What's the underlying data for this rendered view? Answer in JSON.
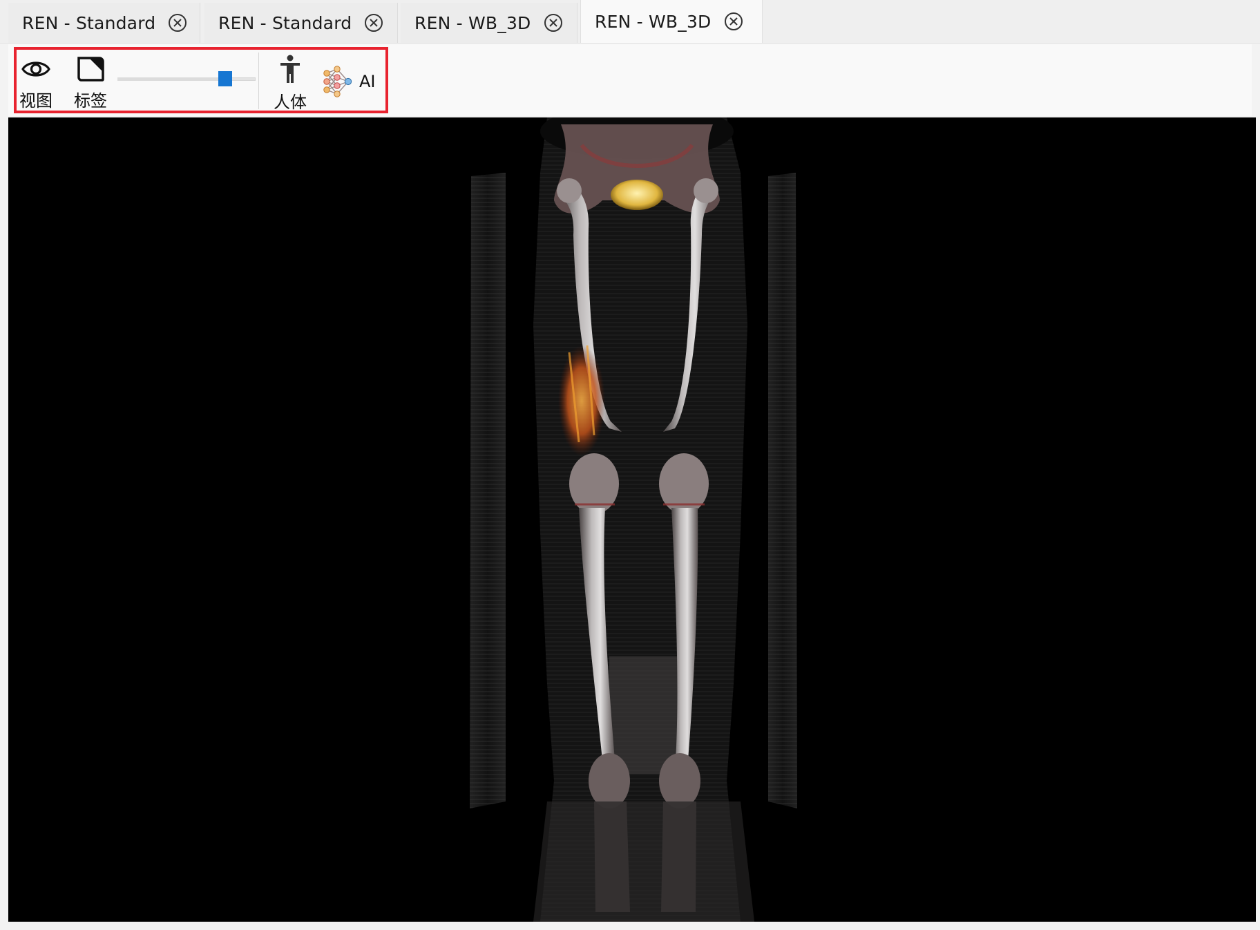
{
  "tabs": [
    {
      "label": "REN - Standard",
      "active": false
    },
    {
      "label": "REN - Standard",
      "active": false
    },
    {
      "label": "REN - WB_3D",
      "active": false
    },
    {
      "label": "REN - WB_3D",
      "active": true
    }
  ],
  "toolbar": {
    "view_label": "视图",
    "tag_label": "标签",
    "body_label": "人体",
    "ai_label": "AI",
    "slider_value": 0.78,
    "highlight_color": "#e8232f",
    "slider_color": "#1676d2"
  },
  "icons": {
    "view": "eye-icon",
    "tag": "label-corner-icon",
    "body": "person-icon",
    "ai": "neural-network-icon",
    "close": "close-circle-icon"
  },
  "viewport": {
    "background": "#000000",
    "content": "3D volume rendering of lower body skeleton"
  }
}
